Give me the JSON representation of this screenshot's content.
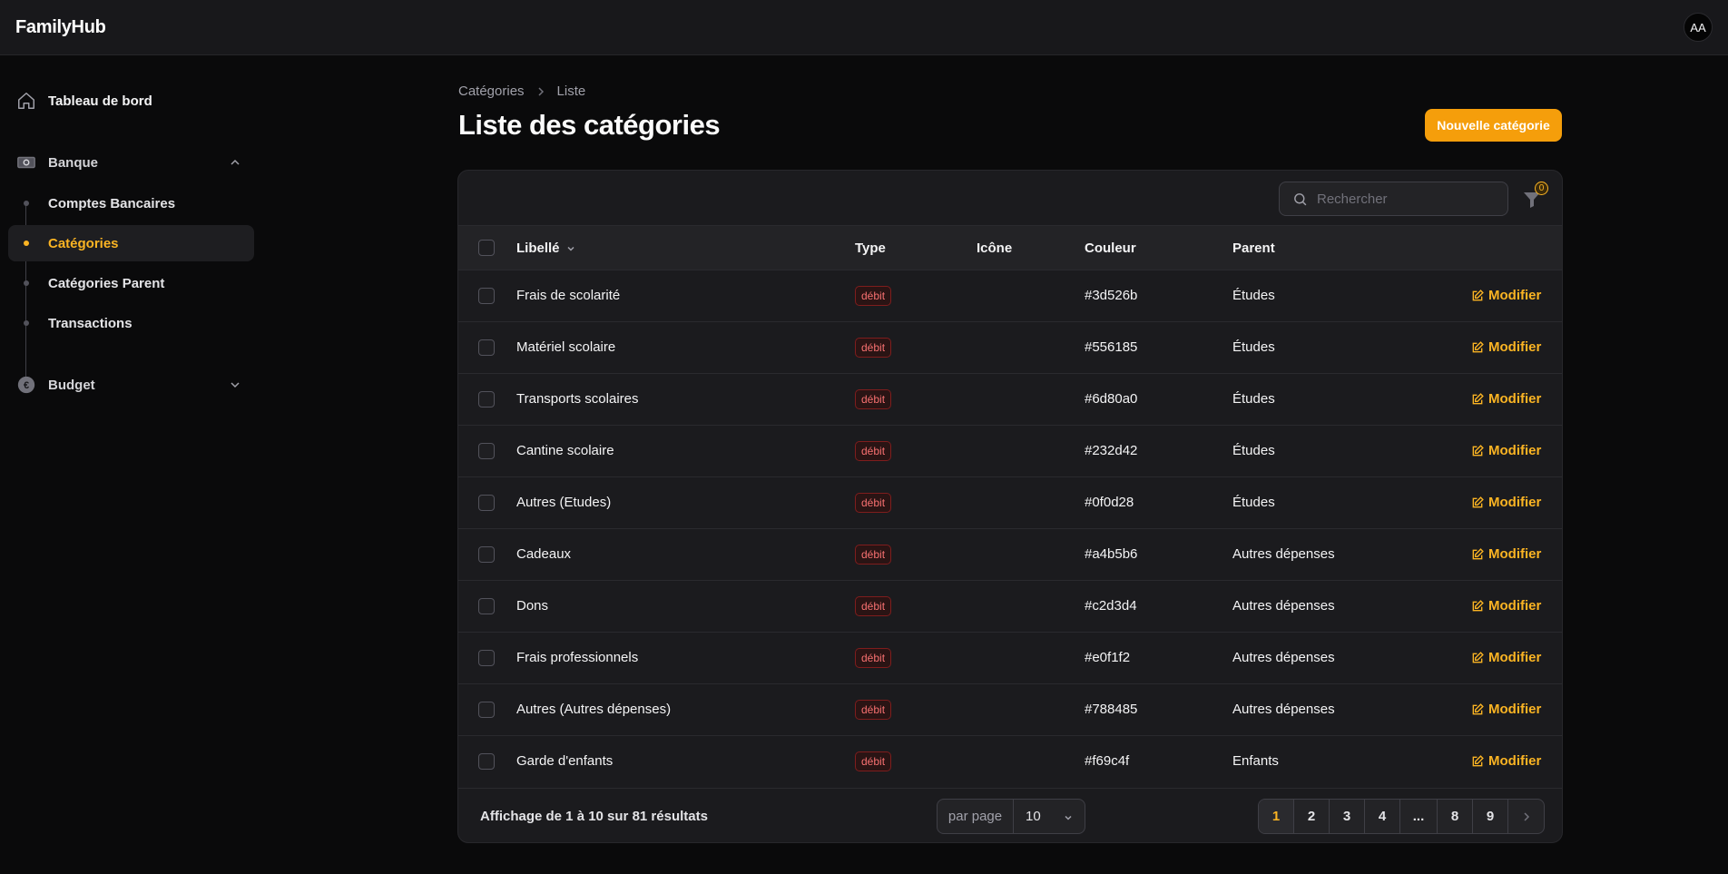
{
  "app": {
    "brand": "FamilyHub",
    "avatar_initials": "AA"
  },
  "sidebar": {
    "dashboard": "Tableau de bord",
    "bank_section": "Banque",
    "bank_items": [
      {
        "label": "Comptes Bancaires"
      },
      {
        "label": "Catégories"
      },
      {
        "label": "Catégories Parent"
      },
      {
        "label": "Transactions"
      }
    ],
    "active_item": "Catégories",
    "budget_section": "Budget"
  },
  "breadcrumb": {
    "root": "Catégories",
    "current": "Liste"
  },
  "page": {
    "title": "Liste des catégories",
    "new_button": "Nouvelle catégorie"
  },
  "toolbar": {
    "search_placeholder": "Rechercher",
    "filter_count": "0"
  },
  "table": {
    "headers": {
      "label": "Libellé",
      "type": "Type",
      "icon": "Icône",
      "color": "Couleur",
      "parent": "Parent"
    },
    "action_label": "Modifier",
    "rows": [
      {
        "label": "Frais de scolarité",
        "type": "débit",
        "color": "#3d526b",
        "parent": "Études"
      },
      {
        "label": "Matériel scolaire",
        "type": "débit",
        "color": "#556185",
        "parent": "Études"
      },
      {
        "label": "Transports scolaires",
        "type": "débit",
        "color": "#6d80a0",
        "parent": "Études"
      },
      {
        "label": "Cantine scolaire",
        "type": "débit",
        "color": "#232d42",
        "parent": "Études"
      },
      {
        "label": "Autres (Etudes)",
        "type": "débit",
        "color": "#0f0d28",
        "parent": "Études"
      },
      {
        "label": "Cadeaux",
        "type": "débit",
        "color": "#a4b5b6",
        "parent": "Autres dépenses"
      },
      {
        "label": "Dons",
        "type": "débit",
        "color": "#c2d3d4",
        "parent": "Autres dépenses"
      },
      {
        "label": "Frais professionnels",
        "type": "débit",
        "color": "#e0f1f2",
        "parent": "Autres dépenses"
      },
      {
        "label": "Autres (Autres dépenses)",
        "type": "débit",
        "color": "#788485",
        "parent": "Autres dépenses"
      },
      {
        "label": "Garde d'enfants",
        "type": "débit",
        "color": "#f69c4f",
        "parent": "Enfants"
      }
    ]
  },
  "footer": {
    "summary": "Affichage de 1 à 10 sur 81 résultats",
    "per_page_label": "par page",
    "per_page_value": "10",
    "pages": [
      "1",
      "2",
      "3",
      "4",
      "...",
      "8",
      "9"
    ],
    "current_page": "1"
  },
  "colors": {
    "accent": "#f59e0b",
    "active_text": "#fbb423",
    "debit_badge": "#f87171"
  }
}
